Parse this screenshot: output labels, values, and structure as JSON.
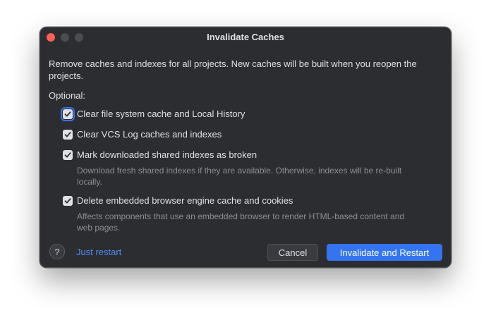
{
  "dialog": {
    "title": "Invalidate Caches",
    "message": "Remove caches and indexes for all projects. New caches will be built when you reopen the projects.",
    "optional_label": "Optional:",
    "options": [
      {
        "label": "Clear file system cache and Local History",
        "checked": true,
        "hint": ""
      },
      {
        "label": "Clear VCS Log caches and indexes",
        "checked": true,
        "hint": ""
      },
      {
        "label": "Mark downloaded shared indexes as broken",
        "checked": true,
        "hint": "Download fresh shared indexes if they are available. Otherwise, indexes will be re-built locally."
      },
      {
        "label": "Delete embedded browser engine cache and cookies",
        "checked": true,
        "hint": "Affects components that use an embedded browser to render HTML-based content and web pages."
      }
    ],
    "help_symbol": "?",
    "just_restart_label": "Just restart",
    "cancel_label": "Cancel",
    "primary_label": "Invalidate and Restart"
  },
  "colors": {
    "background": "#2b2d30",
    "accent": "#3574f0",
    "link": "#548af7",
    "text": "#dfe1e5",
    "hint": "#8c8f94",
    "close": "#ff5f57"
  }
}
